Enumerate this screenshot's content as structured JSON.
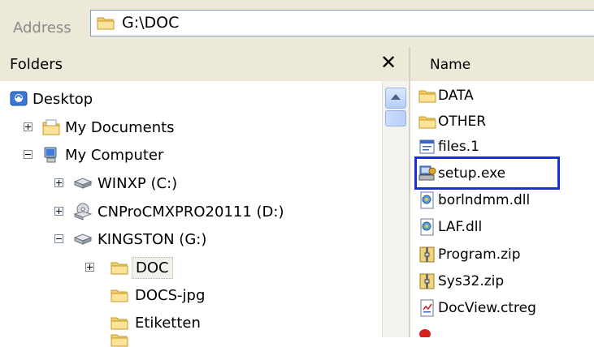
{
  "address": {
    "label": "Address",
    "path": "G:\\DOC"
  },
  "folders_pane": {
    "title": "Folders",
    "close_glyph": "✕",
    "tree": [
      {
        "label": "Desktop",
        "icon": "desktop-icon"
      },
      {
        "label": "My Documents",
        "icon": "my-documents-icon"
      },
      {
        "label": "My Computer",
        "icon": "my-computer-icon"
      },
      {
        "label": "WINXP (C:)",
        "icon": "hard-drive-icon"
      },
      {
        "label": "CNProCMXPRO20111 (D:)",
        "icon": "cd-drive-icon"
      },
      {
        "label": "KINGSTON (G:)",
        "icon": "removable-drive-icon"
      },
      {
        "label": "DOC",
        "icon": "folder-icon"
      },
      {
        "label": "DOCS-jpg",
        "icon": "folder-icon"
      },
      {
        "label": "Etiketten",
        "icon": "folder-icon"
      }
    ]
  },
  "file_list": {
    "column_name": "Name",
    "items": [
      {
        "label": "DATA",
        "icon": "folder-icon"
      },
      {
        "label": "OTHER",
        "icon": "folder-icon"
      },
      {
        "label": "files.1",
        "icon": "generic-file-icon"
      },
      {
        "label": "setup.exe",
        "icon": "setup-exe-icon"
      },
      {
        "label": "borlndmm.dll",
        "icon": "dll-file-icon"
      },
      {
        "label": "LAF.dll",
        "icon": "dll-file-icon"
      },
      {
        "label": "Program.zip",
        "icon": "zip-file-icon"
      },
      {
        "label": "Sys32.zip",
        "icon": "zip-file-icon"
      },
      {
        "label": "DocView.ctreg",
        "icon": "registry-file-icon"
      }
    ]
  },
  "colors": {
    "highlight": "#1a2ddf",
    "toolbar": "#ece9d8",
    "folder": "#f5d57a"
  }
}
